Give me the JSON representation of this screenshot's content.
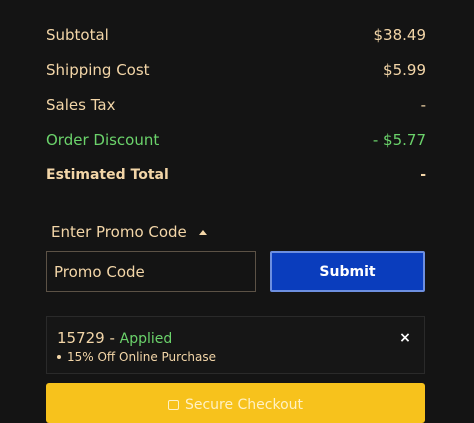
{
  "summary": {
    "subtotal_label": "Subtotal",
    "subtotal_value": "$38.49",
    "shipping_label": "Shipping Cost",
    "shipping_value": "$5.99",
    "tax_label": "Sales Tax",
    "tax_value": "-",
    "discount_label": "Order Discount",
    "discount_value": "- $5.77",
    "total_label": "Estimated Total",
    "total_value": "-"
  },
  "promo": {
    "toggle_label": "Enter Promo Code",
    "input_placeholder": "Promo Code",
    "submit_label": "Submit"
  },
  "applied": {
    "code": "15729",
    "separator": " - ",
    "status": "Applied",
    "description": "15% Off Online Purchase",
    "remove_symbol": "×"
  },
  "checkout": {
    "label": "Secure Checkout"
  },
  "colors": {
    "background": "#141414",
    "text": "#f3d6a8",
    "discount": "#6bd36b",
    "submit": "#0a3dbd",
    "checkout": "#f7c21c"
  }
}
